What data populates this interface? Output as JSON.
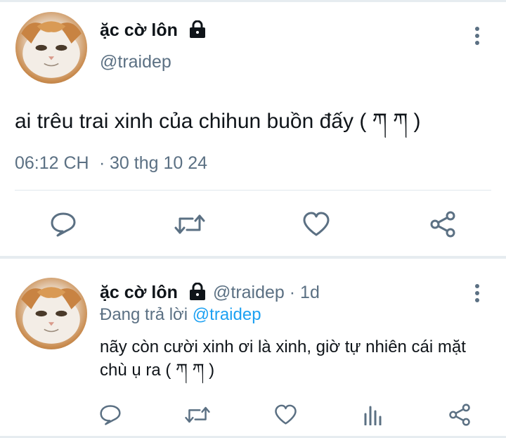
{
  "main_tweet": {
    "display_name": "ặc cờ lôn",
    "handle": "@traidep",
    "text": "ai trêu trai xinh của chihun buồn đấy ( ཀ ཀ )",
    "time": "06:12 CH",
    "date_separator": "·",
    "date": "30 thg 10 24"
  },
  "reply_tweet": {
    "display_name": "ặc cờ lôn",
    "handle_time": "@traidep · 1d",
    "replying_prefix": "Đang trả lời",
    "replying_handle": "@traidep",
    "text": "nãy còn cười xinh ơi là xinh, giờ tự nhiên cái mặt chù ụ ra ( ཀ ཀ )"
  },
  "icons": {
    "lock": "lock-icon",
    "more": "more-vertical-icon",
    "reply": "reply-icon",
    "retweet": "retweet-icon",
    "like": "heart-icon",
    "analytics": "analytics-icon",
    "share": "share-icon"
  },
  "colors": {
    "text": "#0f1419",
    "secondary": "#5b7083",
    "mention": "#1da1f2",
    "divider": "#e6ecf0"
  }
}
